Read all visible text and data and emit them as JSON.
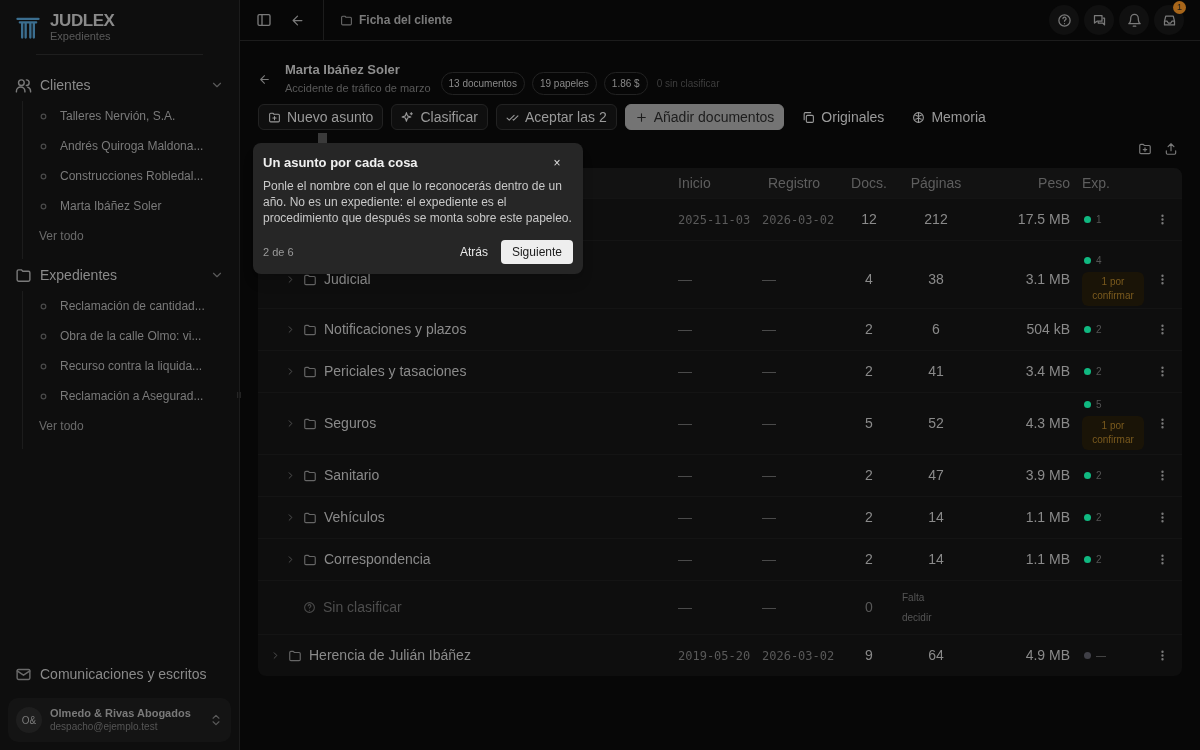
{
  "sidebar": {
    "brand": {
      "name": "JUDLEX",
      "subtitle": "Expedientes"
    },
    "sections": [
      {
        "kind": "clients",
        "label": "Clientes",
        "expanded": true,
        "items": [
          "Talleres Nervión, S.A.",
          "Andrés Quiroga Maldona...",
          "Construcciones Robledal...",
          "Marta Ibáñez Soler"
        ],
        "more": "Ver todo"
      },
      {
        "kind": "cases",
        "label": "Expedientes",
        "expanded": true,
        "items": [
          "Reclamación de cantidad...",
          "Obra de la calle Olmo: vi...",
          "Recurso contra la liquida...",
          "Reclamación a Asegurad..."
        ],
        "more": "Ver todo"
      }
    ],
    "footer_link": "Comunicaciones y escritos",
    "account": {
      "initials": "O&",
      "name": "Olmedo & Rivas Abogados",
      "email": "despacho@ejemplo.test"
    }
  },
  "topbar": {
    "breadcrumb": "Ficha del cliente",
    "inbox_badge": "1"
  },
  "client": {
    "name": "Marta Ibáñez Soler",
    "subtitle": "Accidente de tráfico de marzo",
    "chips": [
      "13 documentos",
      "19 papeles",
      "1.86 $"
    ],
    "note": "0 sin clasificar"
  },
  "toolbar": [
    {
      "kind": "folder-plus",
      "label": "Nuevo asunto"
    },
    {
      "kind": "sparkle",
      "label": "Clasificar"
    },
    {
      "kind": "check",
      "label": "Aceptar las 2"
    },
    {
      "kind": "plus",
      "label": "Añadir documentos"
    },
    {
      "kind": "copy",
      "label": "Originales"
    },
    {
      "kind": "brain",
      "label": "Memoria"
    }
  ],
  "table": {
    "columns": [
      "Inicio",
      "Registro",
      "Docs.",
      "Páginas",
      "Peso",
      "Exp."
    ],
    "rows": [
      {
        "kind": "matter",
        "start": "2025-11-03",
        "registered": "2026-03-02",
        "docs": "12",
        "pages": "212",
        "size": "17.5 MB",
        "exp": {
          "color": "#10b981",
          "count": "1"
        },
        "children": [
          {
            "kind": "folder",
            "name": "Judicial",
            "start": "—",
            "registered": "—",
            "docs": "4",
            "pages": "38",
            "size": "3.1 MB",
            "exp": {
              "color": "#10b981",
              "count": "4"
            },
            "pending": "1 por confirmar"
          },
          {
            "kind": "folder",
            "name": "Notificaciones y plazos",
            "start": "—",
            "registered": "—",
            "docs": "2",
            "pages": "6",
            "size": "504 kB",
            "exp": {
              "color": "#10b981",
              "count": "2"
            }
          },
          {
            "kind": "folder",
            "name": "Periciales y tasaciones",
            "start": "—",
            "registered": "—",
            "docs": "2",
            "pages": "41",
            "size": "3.4 MB",
            "exp": {
              "color": "#10b981",
              "count": "2"
            }
          },
          {
            "kind": "folder",
            "name": "Seguros",
            "start": "—",
            "registered": "—",
            "docs": "5",
            "pages": "52",
            "size": "4.3 MB",
            "exp": {
              "color": "#10b981",
              "count": "5"
            },
            "pending": "1 por confirmar"
          },
          {
            "kind": "folder",
            "name": "Sanitario",
            "start": "—",
            "registered": "—",
            "docs": "2",
            "pages": "47",
            "size": "3.9 MB",
            "exp": {
              "color": "#10b981",
              "count": "2"
            }
          },
          {
            "kind": "folder",
            "name": "Vehículos",
            "start": "—",
            "registered": "—",
            "docs": "2",
            "pages": "14",
            "size": "1.1 MB",
            "exp": {
              "color": "#10b981",
              "count": "2"
            }
          },
          {
            "kind": "folder",
            "name": "Correspondencia",
            "start": "—",
            "registered": "—",
            "docs": "2",
            "pages": "14",
            "size": "1.1 MB",
            "exp": {
              "color": "#10b981",
              "count": "2"
            }
          },
          {
            "kind": "unclassified",
            "name": "Sin clasificar",
            "start": "—",
            "registered": "—",
            "docs": "0",
            "pages": "Falta decidir"
          }
        ]
      },
      {
        "kind": "matter",
        "name": "Herencia de Julián Ibáñez",
        "start": "2019-05-20",
        "registered": "2026-03-02",
        "docs": "9",
        "pages": "64",
        "size": "4.9 MB",
        "exp": {
          "color": "#3f3f46",
          "count": "—"
        }
      }
    ]
  },
  "tour": {
    "title": "Un asunto por cada cosa",
    "body": "Ponle el nombre con el que lo reconocerás dentro de un año. No es un expediente: el expediente es el procedimiento que después se monta sobre este papeleo.",
    "close": "×",
    "step": "2 de 6",
    "back": "Atrás",
    "next": "Siguiente"
  }
}
